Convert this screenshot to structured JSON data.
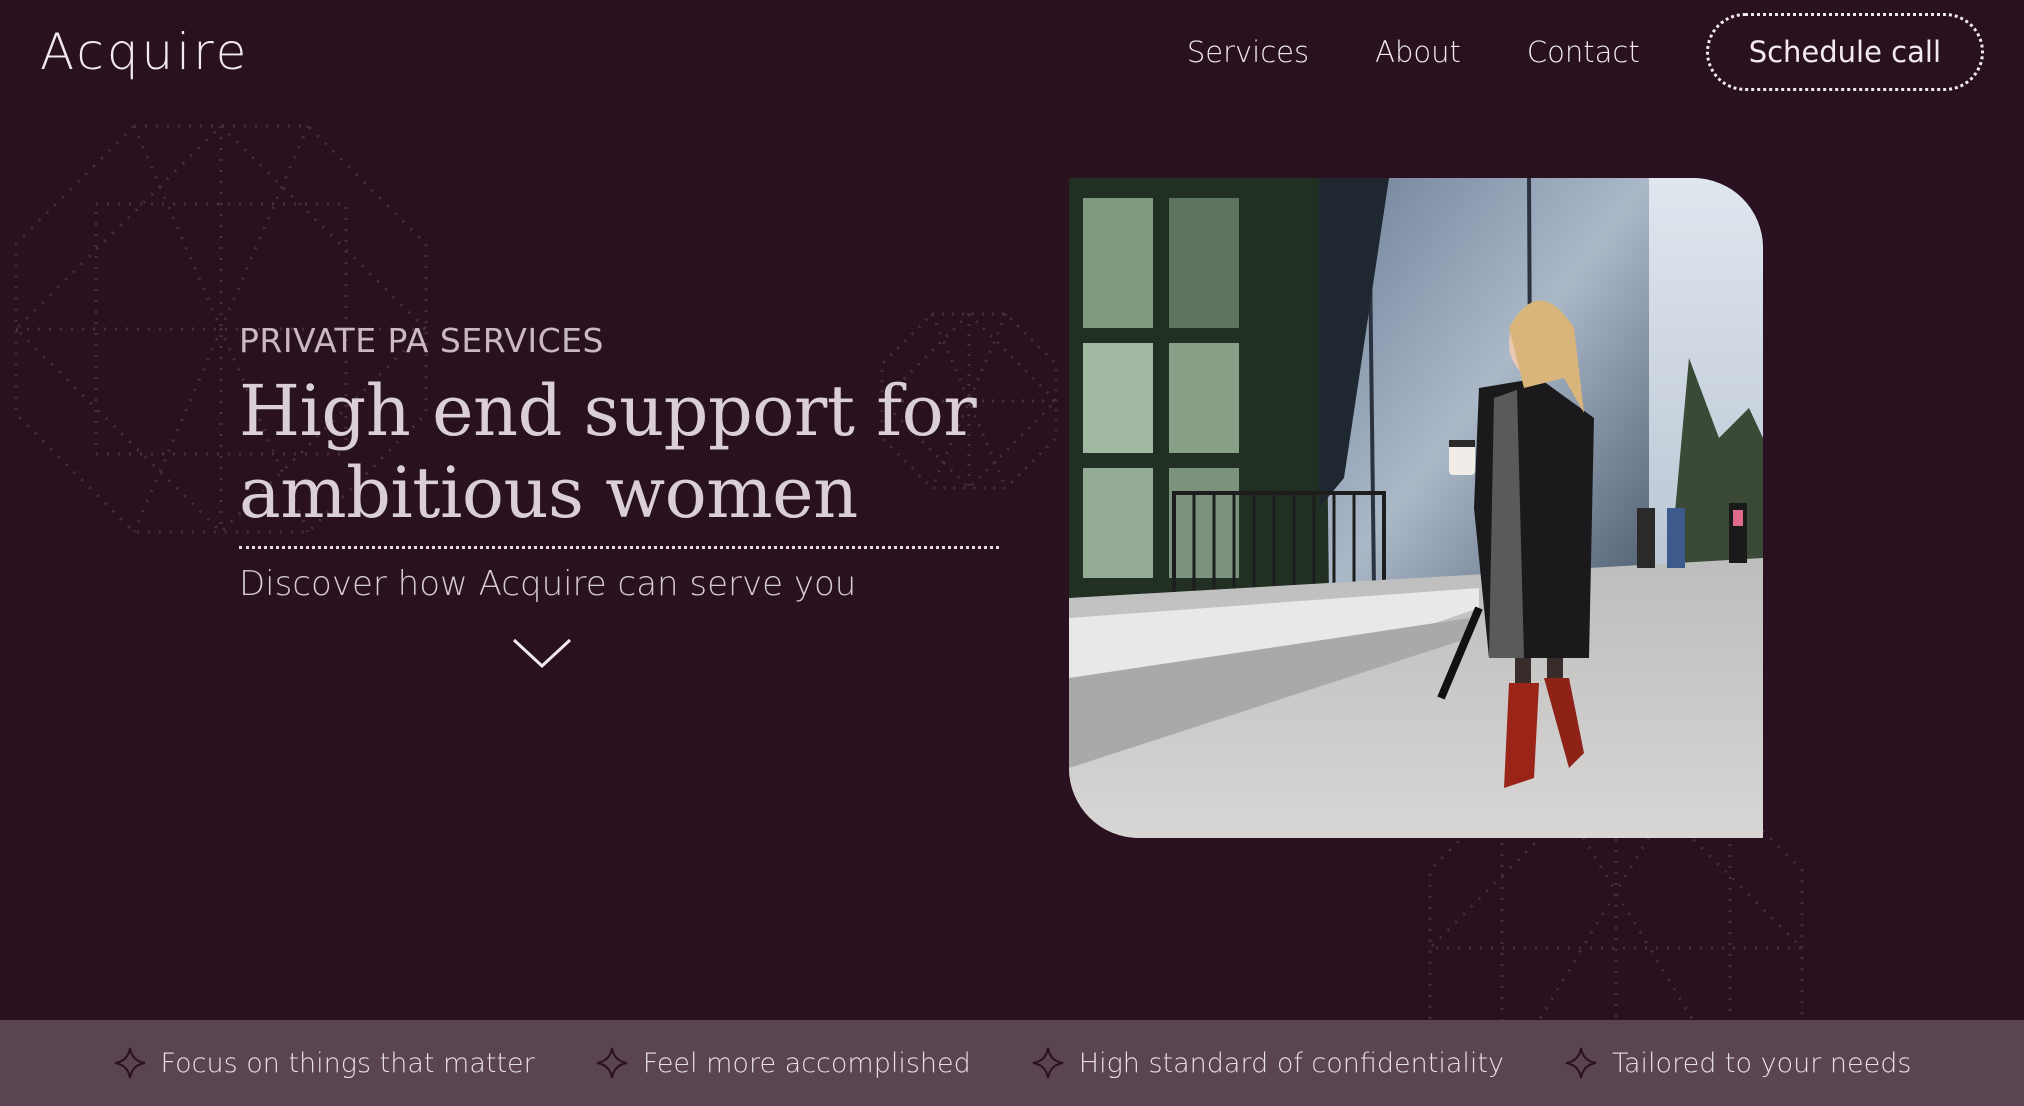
{
  "brand": {
    "logo_text": "Acquire"
  },
  "nav": {
    "links": [
      "Services",
      "About",
      "Contact"
    ],
    "cta_label": "Schedule call"
  },
  "hero": {
    "eyebrow": "PRIVATE PA SERVICES",
    "headline_line1": "High end support for",
    "headline_line2": "ambitious women",
    "subline": "Discover how Acquire can serve you",
    "scroll_icon": "chevron-down-icon",
    "image_alt": "Woman in a dark coat and red boots walking outside a glass office building while on the phone holding a coffee"
  },
  "benefits": [
    {
      "icon": "sparkle-icon",
      "label": "Focus on things that matter"
    },
    {
      "icon": "sparkle-icon",
      "label": "Feel more accomplished"
    },
    {
      "icon": "sparkle-icon",
      "label": "High standard of confidentiality"
    },
    {
      "icon": "sparkle-icon",
      "label": "Tailored to your needs"
    }
  ],
  "colors": {
    "background": "#2a1120",
    "benefits_bar": "#5a4452",
    "text_light": "#f2eaef"
  }
}
